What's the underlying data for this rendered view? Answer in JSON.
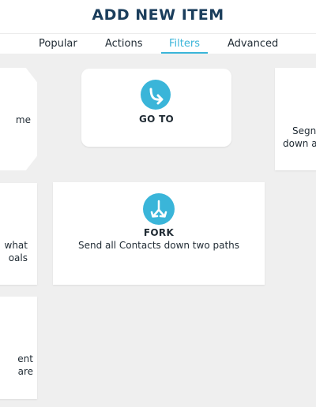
{
  "header": {
    "title": "ADD NEW ITEM"
  },
  "tabs": [
    {
      "label": "Popular",
      "active": false
    },
    {
      "label": "Actions",
      "active": false
    },
    {
      "label": "Filters",
      "active": true
    },
    {
      "label": "Advanced",
      "active": false
    }
  ],
  "cards": {
    "left_top": {
      "text": "me"
    },
    "goto": {
      "title": "GO TO",
      "icon": "go-to-icon"
    },
    "right_top": {
      "line1": "Segn",
      "line2": "down a"
    },
    "left_mid": {
      "line1": "what",
      "line2": "oals"
    },
    "fork": {
      "title": "FORK",
      "description": "Send all Contacts down two paths",
      "icon": "fork-icon"
    },
    "left_bottom": {
      "line1": "ent",
      "line2": "are"
    }
  },
  "colors": {
    "accent": "#3ab5d9",
    "title": "#1b3e5c",
    "canvas": "#efefef"
  }
}
